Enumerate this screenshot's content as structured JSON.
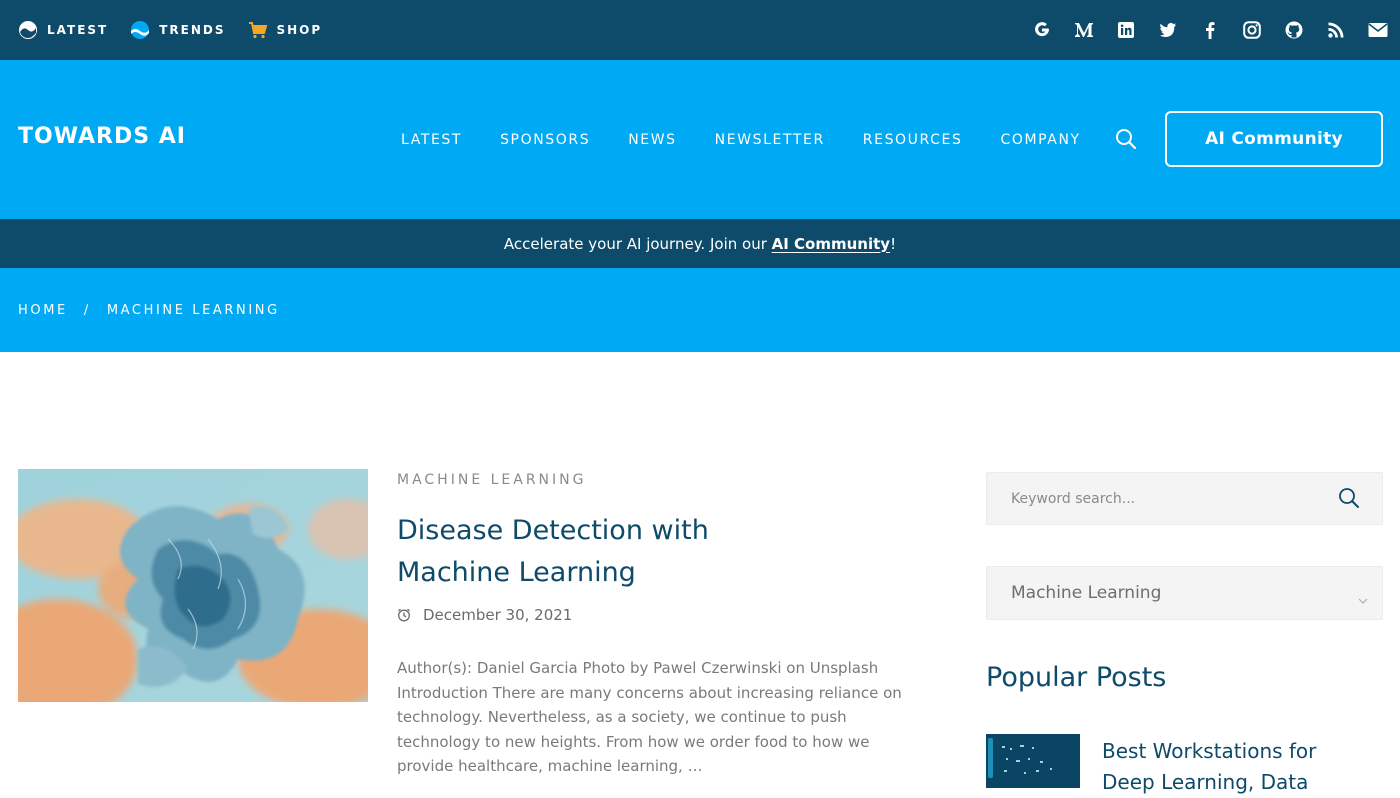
{
  "topbar": {
    "items": [
      {
        "label": "LATEST",
        "icon": "globe-icon"
      },
      {
        "label": "TRENDS",
        "icon": "wave-icon"
      },
      {
        "label": "SHOP",
        "icon": "cart-icon"
      }
    ],
    "socials": [
      "google-icon",
      "medium-icon",
      "linkedin-icon",
      "twitter-icon",
      "facebook-icon",
      "instagram-icon",
      "github-icon",
      "rss-icon",
      "email-icon"
    ]
  },
  "header": {
    "logo": "TOWARDS AI",
    "nav": [
      "LATEST",
      "SPONSORS",
      "NEWS",
      "NEWSLETTER",
      "RESOURCES",
      "COMPANY"
    ],
    "cta": "AI Community"
  },
  "announcement": {
    "text": "Accelerate your AI journey. Join our ",
    "link": "AI Community",
    "suffix": "!"
  },
  "breadcrumb": {
    "home": "HOME",
    "separator": "/",
    "current": "MACHINE LEARNING"
  },
  "article": {
    "category": "MACHINE LEARNING",
    "title": "Disease Detection with Machine Learning",
    "date": "December 30, 2021",
    "excerpt": "Author(s): Daniel Garcia Photo by Pawel Czerwinski on Unsplash Introduction There are many concerns about increasing reliance on technology. Nevertheless, as a society, we continue to push technology to new heights. From how we order food to how we provide healthcare, machine learning, …"
  },
  "sidebar": {
    "search_placeholder": "Keyword search...",
    "category_selected": "Machine Learning",
    "popular_heading": "Popular Posts",
    "popular_first_title": "Best Workstations for Deep Learning, Data"
  },
  "colors": {
    "dark": "#0e4a6a",
    "brand": "#00a9f4",
    "text_muted": "#7a7a7a"
  }
}
